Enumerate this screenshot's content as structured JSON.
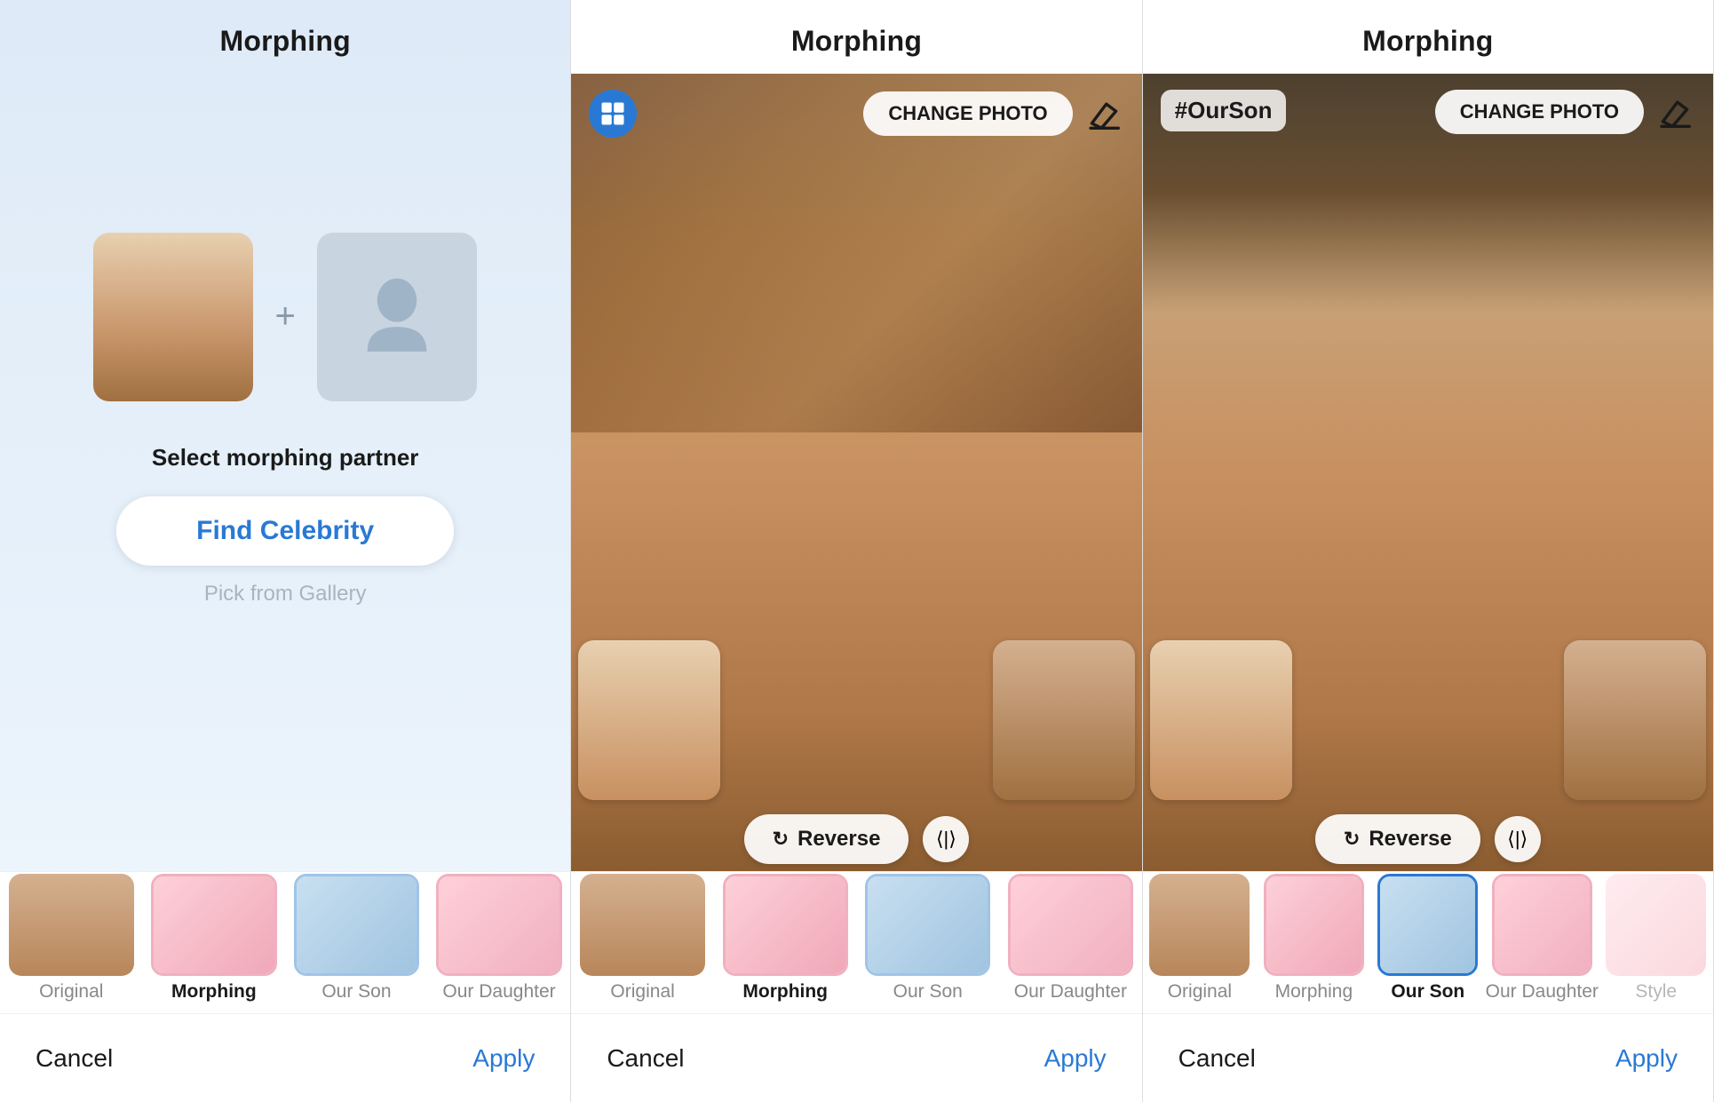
{
  "panels": [
    {
      "id": "panel-1",
      "title": "Morphing",
      "has_top_bar": false,
      "footer": {
        "cancel": "Cancel",
        "apply": "Apply"
      },
      "content": {
        "select_label": "Select morphing partner",
        "find_celebrity_btn": "Find Celebrity",
        "pick_gallery": "Pick from Gallery"
      },
      "tabs": [
        {
          "label": "Original",
          "active": false,
          "border": "none"
        },
        {
          "label": "Morphing",
          "active": true,
          "border": "none"
        },
        {
          "label": "Our Son",
          "active": false,
          "border": "blue"
        },
        {
          "label": "Our Daughter",
          "active": false,
          "border": "pink"
        }
      ]
    },
    {
      "id": "panel-2",
      "title": "Morphing",
      "has_top_bar": true,
      "show_grid_icon": true,
      "change_photo_btn": "CHANGE PHOTO",
      "reverse_btn": "Reverse",
      "footer": {
        "cancel": "Cancel",
        "apply": "Apply"
      },
      "tabs": [
        {
          "label": "Original",
          "active": false,
          "border": "none"
        },
        {
          "label": "Morphing",
          "active": true,
          "border": "none"
        },
        {
          "label": "Our Son",
          "active": false,
          "border": "blue"
        },
        {
          "label": "Our Daughter",
          "active": false,
          "border": "pink"
        }
      ]
    },
    {
      "id": "panel-3",
      "title": "Morphing",
      "has_top_bar": true,
      "show_grid_icon": false,
      "hashtag": "#OurSon",
      "change_photo_btn": "CHANGE PHOTO",
      "reverse_btn": "Reverse",
      "footer": {
        "cancel": "Cancel",
        "apply": "Apply"
      },
      "tabs": [
        {
          "label": "Original",
          "active": false,
          "border": "none"
        },
        {
          "label": "Morphing",
          "active": false,
          "border": "none"
        },
        {
          "label": "Our Son",
          "active": true,
          "border": "blue"
        },
        {
          "label": "Our Daughter",
          "active": false,
          "border": "pink"
        },
        {
          "label": "Style",
          "active": false,
          "border": "none"
        }
      ]
    }
  ],
  "icons": {
    "grid": "grid-icon",
    "eraser": "eraser-icon",
    "reverse": "↻",
    "arrows": "⟨|⟩"
  }
}
